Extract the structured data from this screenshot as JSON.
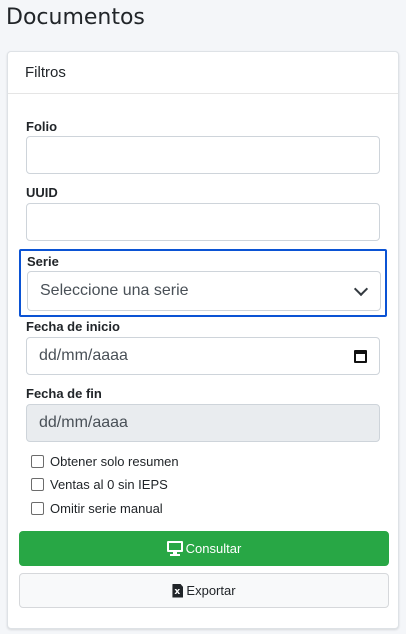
{
  "page": {
    "title": "Documentos"
  },
  "filters": {
    "header": "Filtros",
    "folio": {
      "label": "Folio",
      "value": ""
    },
    "uuid": {
      "label": "UUID",
      "value": ""
    },
    "serie": {
      "label": "Serie",
      "selected": "Seleccione una serie"
    },
    "fecha_inicio": {
      "label": "Fecha de inicio",
      "value": "dd/mm/aaaa"
    },
    "fecha_fin": {
      "label": "Fecha de fin",
      "value": "dd/mm/aaaa",
      "disabled": true
    },
    "checkboxes": [
      {
        "label": "Obtener solo resumen",
        "checked": false
      },
      {
        "label": "Ventas al 0 sin IEPS",
        "checked": false
      },
      {
        "label": "Omitir serie manual",
        "checked": false
      }
    ]
  },
  "actions": {
    "consultar": {
      "label": "Consultar",
      "icon": "monitor-icon",
      "color": "#28a745"
    },
    "exportar": {
      "label": "Exportar",
      "icon": "excel-file-icon"
    }
  },
  "colors": {
    "highlight": "#0b53d4",
    "success": "#28a745"
  }
}
